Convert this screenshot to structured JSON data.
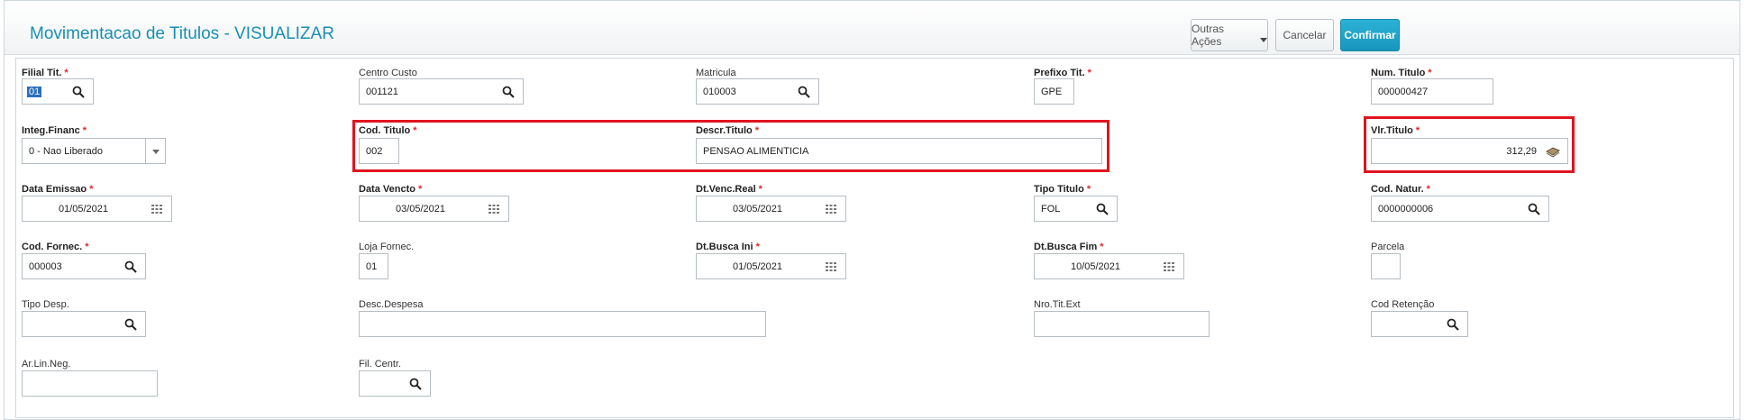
{
  "header": {
    "title": "Movimentacao de Titulos - VISUALIZAR",
    "outras_acoes": "Outras Ações",
    "cancelar": "Cancelar",
    "confirmar": "Confirmar"
  },
  "fields": {
    "filial_tit": {
      "label": "Filial Tit.",
      "value": "01",
      "required": true
    },
    "centro_custo": {
      "label": "Centro Custo",
      "value": "001121",
      "required": false
    },
    "matricula": {
      "label": "Matricula",
      "value": "010003",
      "required": false
    },
    "prefixo_tit": {
      "label": "Prefixo Tit.",
      "value": "GPE",
      "required": true
    },
    "num_titulo": {
      "label": "Num. Titulo",
      "value": "000000427",
      "required": true
    },
    "integ_financ": {
      "label": "Integ.Financ",
      "value": "0 - Nao Liberado",
      "required": true
    },
    "cod_titulo": {
      "label": "Cod. Titulo",
      "value": "002",
      "required": true
    },
    "descr_titulo": {
      "label": "Descr.Titulo",
      "value": "PENSAO ALIMENTICIA",
      "required": true
    },
    "vlr_titulo": {
      "label": "Vlr.Titulo",
      "value": "312,29",
      "required": true
    },
    "data_emissao": {
      "label": "Data Emissao",
      "value": "01/05/2021",
      "required": true
    },
    "data_vencto": {
      "label": "Data Vencto",
      "value": "03/05/2021",
      "required": true
    },
    "dt_venc_real": {
      "label": "Dt.Venc.Real",
      "value": "03/05/2021",
      "required": true
    },
    "tipo_titulo": {
      "label": "Tipo Titulo",
      "value": "FOL",
      "required": true
    },
    "cod_natur": {
      "label": "Cod. Natur.",
      "value": "0000000006",
      "required": true
    },
    "cod_fornec": {
      "label": "Cod. Fornec.",
      "value": "000003",
      "required": true
    },
    "loja_fornec": {
      "label": "Loja Fornec.",
      "value": "01",
      "required": false
    },
    "dt_busca_ini": {
      "label": "Dt.Busca Ini",
      "value": "01/05/2021",
      "required": true
    },
    "dt_busca_fim": {
      "label": "Dt.Busca Fim",
      "value": "10/05/2021",
      "required": true
    },
    "parcela": {
      "label": "Parcela",
      "value": "",
      "required": false
    },
    "tipo_desp": {
      "label": "Tipo Desp.",
      "value": "",
      "required": false
    },
    "desc_despesa": {
      "label": "Desc.Despesa",
      "value": "",
      "required": false
    },
    "nro_tit_ext": {
      "label": "Nro.Tit.Ext",
      "value": "",
      "required": false
    },
    "cod_retencao": {
      "label": "Cod Retenção",
      "value": "",
      "required": false
    },
    "ar_lin_neg": {
      "label": "Ar.Lin.Neg.",
      "value": "",
      "required": false
    },
    "fil_centr": {
      "label": "Fil. Centr.",
      "value": "",
      "required": false
    }
  },
  "required_marker": "*",
  "colors": {
    "title": "#1a8fb3",
    "confirm": "#1796bd",
    "required": "#e0262b",
    "highlight_box": "#e0141f"
  },
  "icons": {
    "lookup": "search-icon",
    "date": "calendar-icon",
    "currency": "money-icon",
    "select": "chevron-down-icon"
  }
}
